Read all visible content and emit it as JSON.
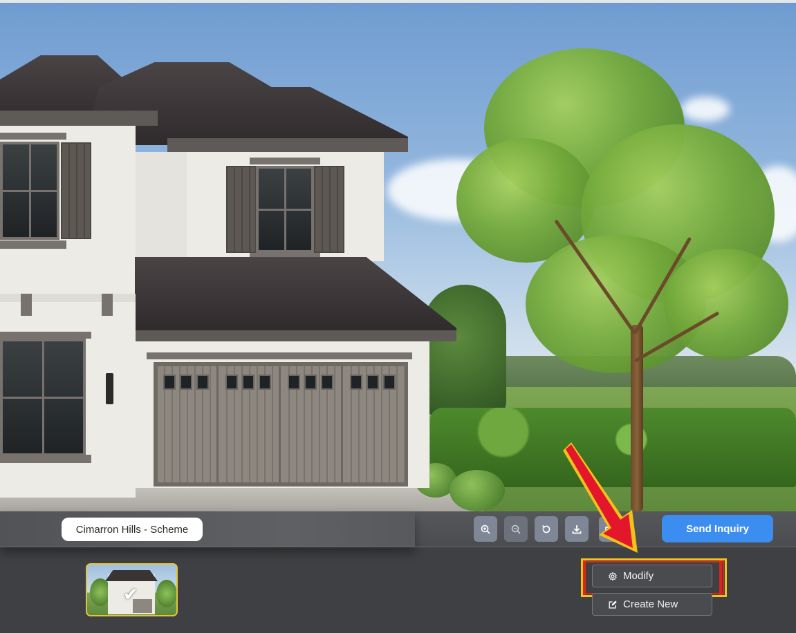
{
  "scheme": {
    "label": "Cimarron Hills - Scheme"
  },
  "toolbar": {
    "zoom_in_icon": "zoom-in-icon",
    "zoom_out_icon": "zoom-out-icon",
    "reset_icon": "rotate-ccw-icon",
    "download_icon": "download-icon",
    "share_icon": "share-icon",
    "send_inquiry_label": "Send Inquiry"
  },
  "actions": {
    "modify_label": "Modify",
    "modify_icon": "gear-icon",
    "create_new_label": "Create New",
    "create_new_icon": "edit-icon"
  },
  "colors": {
    "accent": "#3b8df0",
    "highlight_outer": "#f0c21a",
    "highlight_inner": "#d9261c",
    "thumbnail_border": "#e3c53a"
  }
}
